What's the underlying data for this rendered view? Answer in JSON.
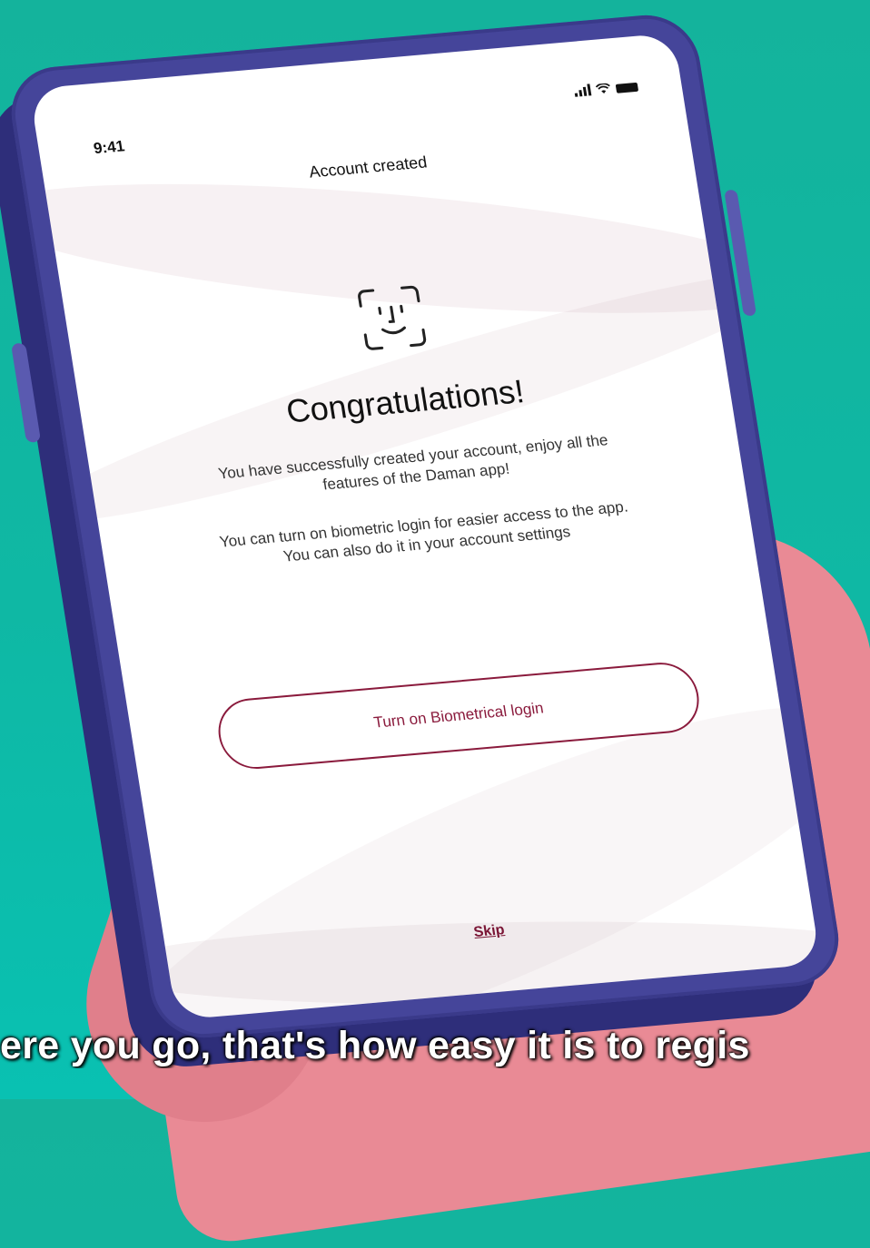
{
  "status_bar": {
    "time": "9:41"
  },
  "screen": {
    "header_title": "Account created",
    "heading": "Congratulations!",
    "message_1": "You have successfully created your account, enjoy all the features of the Daman app!",
    "message_2": "You can turn on biometric login for easier access to the app. You can also do it in your account settings",
    "primary_button": "Turn on Biometrical login",
    "skip_link": "Skip"
  },
  "icons": {
    "biometric": "face-id-icon",
    "signal": "signal-icon",
    "wifi": "wifi-icon",
    "battery": "battery-icon"
  },
  "colors": {
    "accent": "#8a1a3c",
    "phone_body": "#45459a",
    "background": "#14b39c",
    "hand": "#e98a95"
  },
  "caption": "ere you go, that's how easy it is to regis"
}
